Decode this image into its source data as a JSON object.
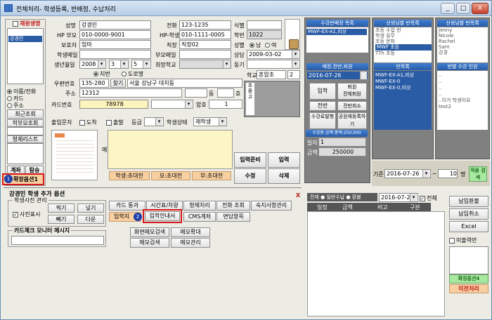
{
  "window": {
    "title": "전체처리- 학생등록, 반배정, 수납처리",
    "min": "_",
    "max": "□",
    "close": "X"
  },
  "left": {
    "header": "재원생명",
    "list": [
      "강경민"
    ],
    "radios": [
      "이름/전화",
      "카드",
      "주소"
    ],
    "btn_recent": "최근조회",
    "btn_parents": "학부모조회",
    "btn_brothers": "형제리스트",
    "btn_account": "계좌",
    "btn_leave": "탐승",
    "btn_ext": "확장옵션1"
  },
  "form": {
    "name_label": "성명",
    "name": "강경민",
    "phone_label": "전화",
    "phone": "123-1235",
    "id_label": "식별",
    "hp_parent_label": "HP 부모",
    "hp_parent": "010-0000-9001",
    "hp_student_label": "HP-학생",
    "hp_student": "010-1111-0005",
    "school_no_label": "학번",
    "school_no": "1022",
    "guardian_label": "보호자",
    "guardian": "엄마",
    "job_label": "직장",
    "job": "직장02",
    "gender_label": "성별",
    "gender_m": "남",
    "gender_f": "여",
    "email_label": "학생메일",
    "parent_mail_label": "부모메일",
    "consult_label": "상담",
    "consult_date": "2009-03-02",
    "birth_label": "생년월일",
    "birth_y": "2008",
    "birth_m": "3",
    "birth_d": "5",
    "hope_school_label": "희망학교",
    "motive_label": "동기",
    "ji_label": "지번",
    "road_label": "도로명",
    "school_label": "학교",
    "school": "혼암초",
    "grade": "2",
    "zip_label": "우편번호",
    "zip": "135-280",
    "find_btn": "찾기",
    "addr1": "서울 강남구 대치동",
    "addr_label": "주소",
    "addr2": "12312",
    "dong": "동",
    "ho": "호",
    "card_label": "카드번호",
    "card": "78978",
    "pw_label": "암호",
    "pw": "1",
    "sms_label": "출입문자",
    "arrive": "도착",
    "depart": "출발",
    "level_label": "등급",
    "status_label": "학생상태",
    "status": "재학생",
    "memo_label": "메모",
    "memo_side": "초중고",
    "btn_sms_student": "학생:초대전",
    "btn_sms_mom": "모:초대전",
    "btn_sms_dad": "부:초대전",
    "btn_prepare": "입력준비",
    "btn_enter": "입력",
    "btn_modify": "수정",
    "btn_delete": "삭제"
  },
  "mid": {
    "header1": "수강반배정 목록",
    "list1": [
      "MWF-EX-A1,비상"
    ],
    "header2": "배정,전반,퇴원",
    "date": "2016-07-26",
    "btn_enroll": "입학",
    "btn_retire": "퇴원",
    "btn_retire_cancel": "전체퇴원",
    "btn_transfer": "전반",
    "btn_transfer_cancel": "전반취소",
    "btn_fee": "수강료발행",
    "btn_fee2": "공원재등록하기",
    "header3": "반목록",
    "list3": [
      "MWF-EX-A1,비상",
      "MWF-EX-0",
      "MWF-EX-0,비상"
    ],
    "header_amt": "수강중 금액 총액:250,000",
    "count_label": "일자",
    "count": "1",
    "amt_label": "금액",
    "amt": "250000"
  },
  "right": {
    "header1": "선생님별 반목록",
    "list1": [
      "Jenny",
      "Nicole",
      "Rachel",
      "Sam",
      "강경"
    ],
    "header2": "반별 수강 인원",
    "list2": [
      "..",
      "..",
      "..",
      "..",
      "..이거 학생이요",
      "test2"
    ],
    "class_list": [
      "초등 수업 반",
      "학생 유무",
      "초등 문화",
      "MWF 초등",
      "TTh 초등"
    ]
  },
  "date_row": {
    "from_label": "기준",
    "from": "2016-07-26",
    "to_label": "~",
    "to": "10",
    "unit": "명",
    "go": "적용 검색"
  },
  "options": {
    "title": "강경민 학생 추가 옵션",
    "photo_group": "학생사진 관리",
    "photo_show": "사진표시",
    "btn_take": "찍기",
    "btn_insert": "넣기",
    "btn_delete": "빼기",
    "btn_down": "다운",
    "monitor_group": "카드체크 모니터 메시지",
    "btn_card": "카드 통과",
    "btn_timetable": "시간표/차량",
    "btn_sibling": "형제처리",
    "btn_phone": "전화 조회",
    "btn_homework": "숙지사항관리",
    "btn_enter_notice": "입학지",
    "btn_guide": "입학안내서",
    "btn_cms": "CMS계좌",
    "btn_consult": "면담항목",
    "btn_memo_search": "화면메모검색",
    "btn_memo_zoom": "메모확대",
    "btn_memo_find": "메모검색",
    "btn_memo_manage": "메모관리",
    "close": "X"
  },
  "pay": {
    "tabs": [
      "전체",
      "일반수납",
      "환불"
    ],
    "date": "2016-07-26",
    "all": "전체",
    "cols": [
      "일정",
      "금액",
      "비고",
      "구분"
    ],
    "btn_pay": "납입환불",
    "btn_cancel": "납입취소",
    "btn_excel": "Excel",
    "receipt": "미출력만",
    "btn_ext": "확장옵션4",
    "btn_close": "미전처리"
  },
  "badges": [
    "1",
    "2"
  ]
}
